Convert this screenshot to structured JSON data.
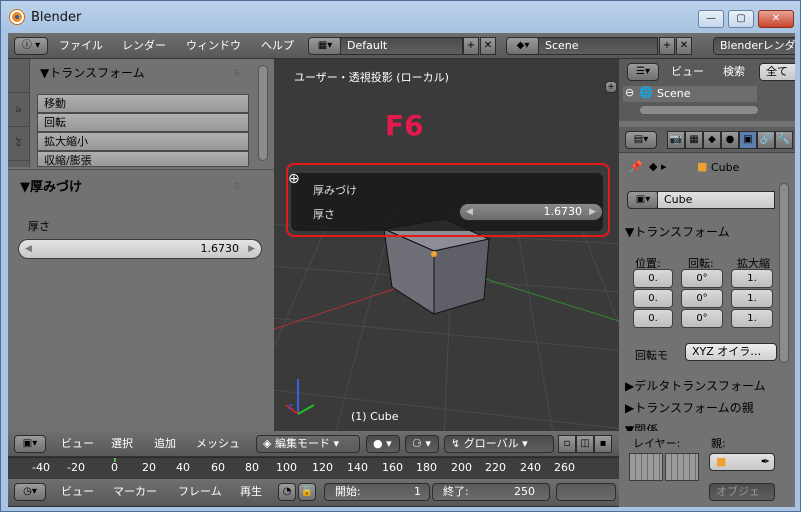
{
  "window": {
    "title": "Blender",
    "min": "—",
    "max": "▢",
    "close": "✕"
  },
  "header": {
    "info_icon": "ⓘ",
    "menus": [
      "ファイル",
      "レンダー",
      "ウィンドウ",
      "ヘルプ"
    ],
    "screen_layout": "Default",
    "scene": "Scene",
    "engine": "Blenderレンダ"
  },
  "left_panel": {
    "transform_header": "▼トランスフォーム",
    "tools": [
      "移動",
      "回転",
      "拡大縮小",
      "収縮/膨張"
    ],
    "solidify_header": "▼厚みづけ",
    "thickness_label": "厚さ",
    "thickness_value": "1.6730"
  },
  "viewport": {
    "view_label": "ユーザー・透視投影 (ローカル)",
    "annotation": "F6",
    "object_label": "(1) Cube",
    "operator_title": "厚みづけ",
    "operator_field_label": "厚さ",
    "operator_field_value": "1.6730"
  },
  "viewport_header": {
    "menus": [
      "ビュー",
      "選択",
      "追加",
      "メッシュ"
    ],
    "mode": "編集モード",
    "orientation": "グローバル"
  },
  "timeline": {
    "ticks": [
      "-40",
      "-20",
      "0",
      "20",
      "40",
      "60",
      "80",
      "100",
      "120",
      "140",
      "160",
      "180",
      "200",
      "220",
      "240",
      "260"
    ],
    "menus": [
      "ビュー",
      "マーカー",
      "フレーム",
      "再生"
    ],
    "start_label": "開始:",
    "start_value": "1",
    "end_label": "終了:",
    "end_value": "250"
  },
  "outliner": {
    "view": "ビュー",
    "search": "検索",
    "filter": "全て",
    "scene_item": "Scene"
  },
  "properties": {
    "breadcrumb_object": "Cube",
    "object_name": "Cube",
    "transform_header": "▼トランスフォーム",
    "location_label": "位置:",
    "rotation_label": "回転:",
    "scale_label": "拡大縮",
    "location": [
      "0.",
      "0.",
      "0."
    ],
    "rotation": [
      "0°",
      "0°",
      "0°"
    ],
    "scale": [
      "1.",
      "1.",
      "1."
    ],
    "rotation_mode_label": "回転モ",
    "rotation_mode_value": "XYZ オイラ…",
    "delta_header": "▶デルタトランスフォーム",
    "parent_inverse_header": "▶トランスフォームの親",
    "relations_header": "▼関係",
    "layer_label": "レイヤー:",
    "parent_label": "親:",
    "object_type_label": "オブジェ"
  },
  "colors": {
    "accent_red": "#e61a1a",
    "annotation": "#e6194f",
    "cube": "#7a7a80"
  }
}
